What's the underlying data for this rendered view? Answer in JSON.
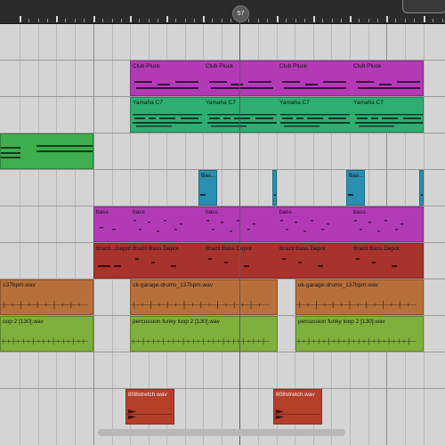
{
  "ruler": {
    "playhead_label": "57"
  },
  "tracks": [
    {
      "id": "t1",
      "clips": []
    },
    {
      "id": "t2",
      "clips": [
        {
          "label": "Club Pluck",
          "sublabels": [
            "Club Pluck",
            "Club Pluck",
            "Club Pluck"
          ],
          "color": "#b23bb5"
        }
      ]
    },
    {
      "id": "t3",
      "clips": [
        {
          "label": "Yamaha C7",
          "sublabels": [
            "Yamaha C7",
            "Yamaha C7",
            "Yamaha C7"
          ],
          "color": "#2fae72"
        }
      ]
    },
    {
      "id": "t4",
      "clips": [
        {
          "label": "",
          "color": "#3fae4f"
        }
      ]
    },
    {
      "id": "t5",
      "clips": [
        {
          "label": "Bas...",
          "color": "#2a8fb0"
        },
        {
          "label": "",
          "color": "#2a8fb0"
        },
        {
          "label": "Bas...",
          "color": "#2a8fb0"
        },
        {
          "label": "",
          "color": "#2a8fb0"
        }
      ]
    },
    {
      "id": "t6",
      "clips": [
        {
          "label": "bass",
          "sublabels": [
            "bass",
            "bass",
            "bass",
            "bass"
          ],
          "color": "#b23bb5"
        }
      ]
    },
    {
      "id": "t7",
      "clips": [
        {
          "label": "Brazil...Depot",
          "sublabels": [
            "Brazil Bass Depot",
            "Brazil Bass Depot",
            "Brazil Bass Depot",
            "Brazil Bass Depot"
          ],
          "color": "#a8332d"
        }
      ]
    },
    {
      "id": "t8",
      "clips": [
        {
          "label": "137bpm.wav",
          "color": "#b8703a"
        },
        {
          "label": "uk-garage-drums_137bpm.wav",
          "color": "#b8703a"
        },
        {
          "label": "uk-garage-drums_137bpm.wav",
          "color": "#b8703a"
        }
      ]
    },
    {
      "id": "t9",
      "clips": [
        {
          "label": "oop 2 [130].wav",
          "color": "#7fb03c"
        },
        {
          "label": "percussion funky loop 2 [130].wav",
          "color": "#7fb03c"
        },
        {
          "label": "percussion funky loop 2 [130].wav",
          "color": "#7fb03c"
        }
      ]
    },
    {
      "id": "t10",
      "clips": []
    },
    {
      "id": "t11",
      "clips": [
        {
          "label": "808stretch.wav",
          "color": "#b5402a"
        },
        {
          "label": "808stretch.wav",
          "color": "#b5402a"
        }
      ]
    }
  ]
}
